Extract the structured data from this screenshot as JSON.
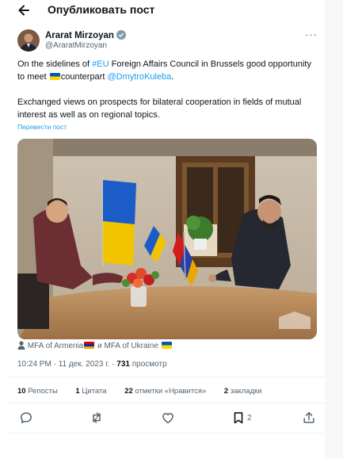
{
  "header": {
    "title": "Опубликовать пост"
  },
  "author": {
    "name": "Ararat Mirzoyan",
    "handle": "@AraratMirzoyan"
  },
  "tweet": {
    "p1_pre": "On the sidelines of ",
    "p1_hashtag": "#EU",
    "p1_mid": " Foreign Affairs Council in Brussels good opportunity to meet ",
    "p1_post": "counterpart ",
    "p1_mention": "@DmytroKuleba",
    "p1_end": ".",
    "p2": "Exchanged views on prospects for bilateral cooperation in fields of mutual interest as well as on regional topics.",
    "translate_label": "Перевести пост"
  },
  "tagged": {
    "a": "MFA of Armenia",
    "and": " и ",
    "b": "MFA of Ukraine"
  },
  "meta": {
    "time_date": "10:24 PM · 11 дек. 2023 г. · ",
    "views": "731",
    "views_label": " просмотр"
  },
  "stats": {
    "reposts_count": "10",
    "reposts_label": " Репосты",
    "quotes_count": "1",
    "quotes_label": " Цитата",
    "likes_count": "22",
    "likes_label": " отметки «Нравится»",
    "bookmarks_count": "2",
    "bookmarks_label": " закладки"
  },
  "actions": {
    "bookmark_count": "2"
  },
  "colors": {
    "link": "#1d9bf0",
    "muted": "#536471",
    "text": "#0f1419"
  }
}
